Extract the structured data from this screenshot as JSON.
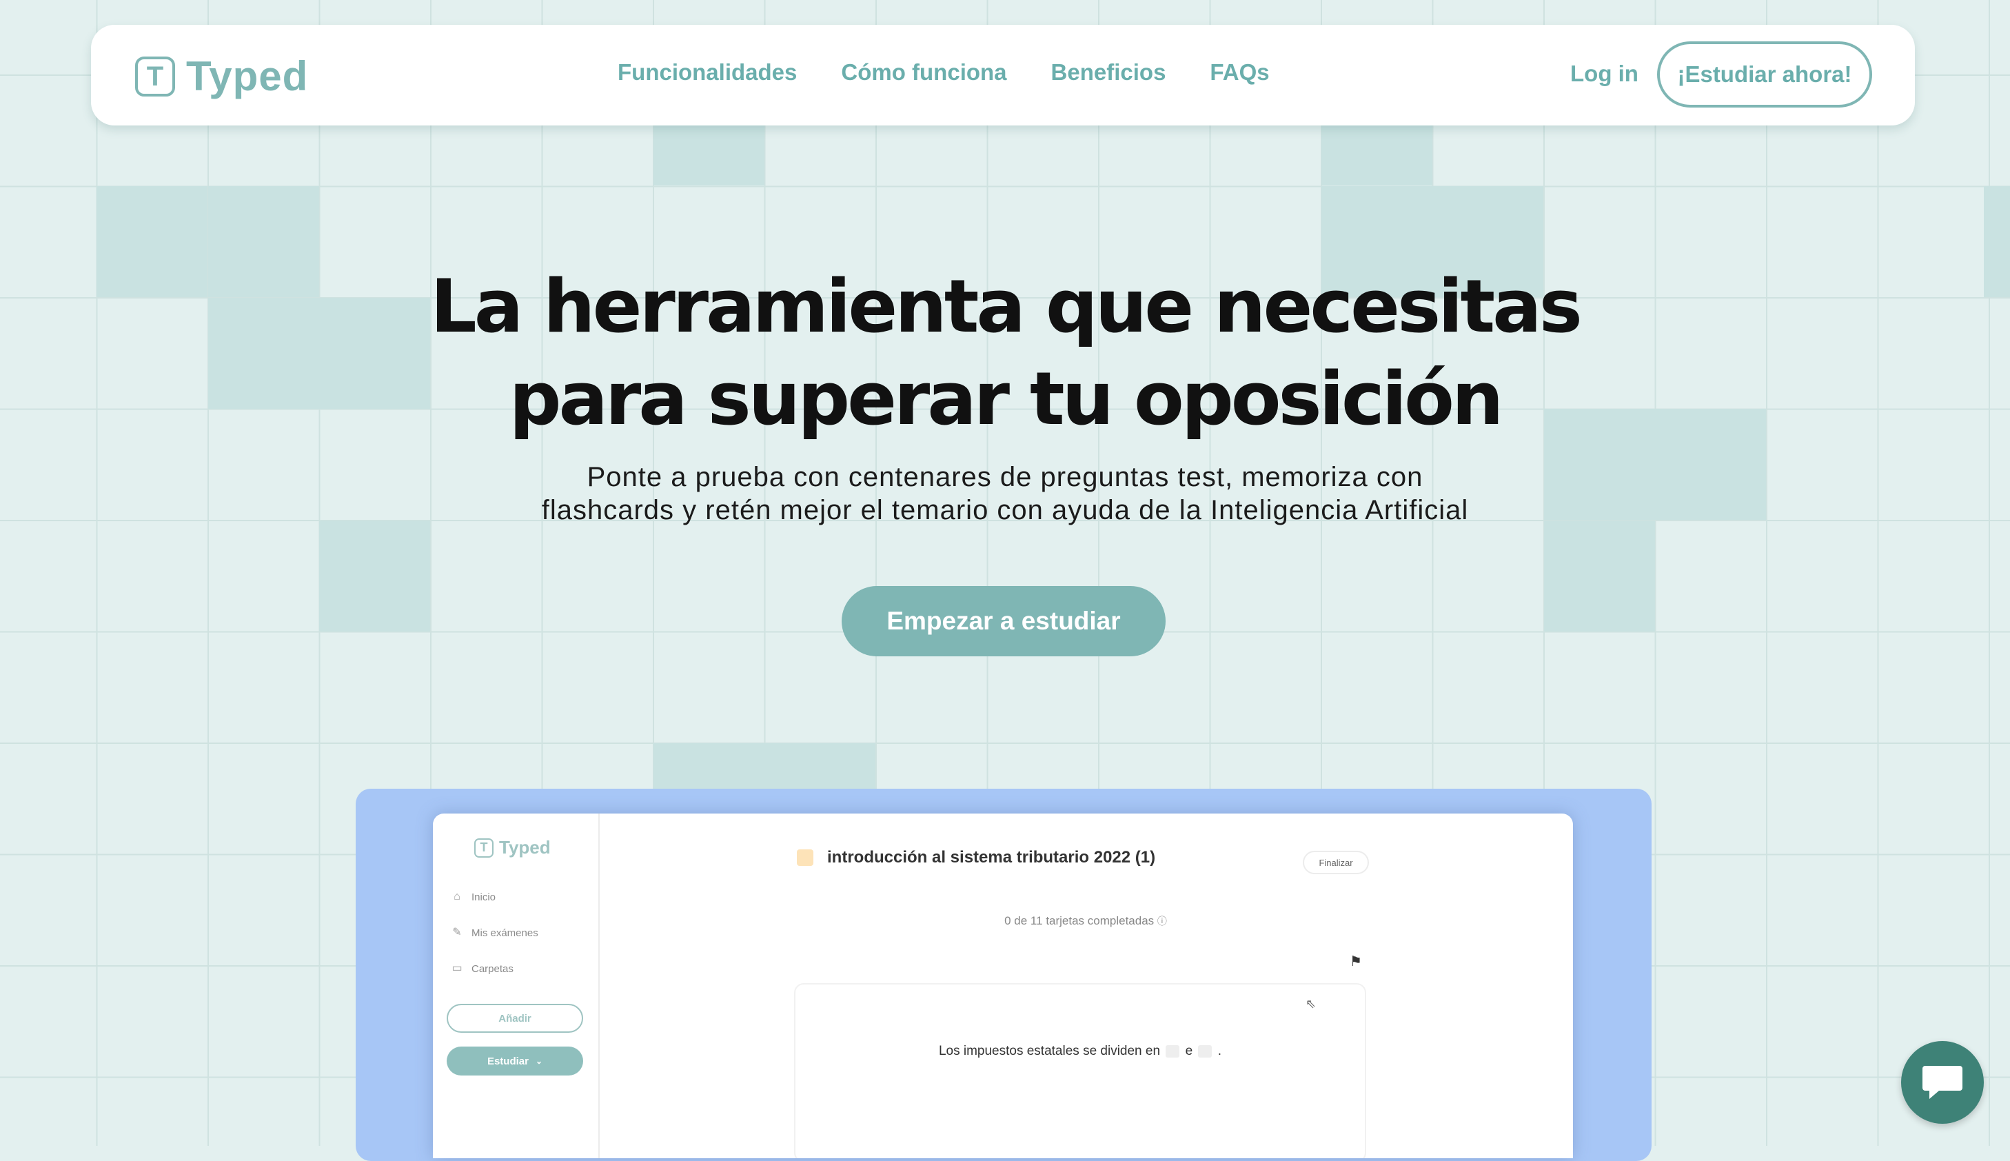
{
  "brand": {
    "logo_letter": "T",
    "name": "Typed",
    "color": "#7fb6b4"
  },
  "nav": {
    "links": [
      {
        "label": "Funcionalidades"
      },
      {
        "label": "Cómo funciona"
      },
      {
        "label": "Beneficios"
      },
      {
        "label": "FAQs"
      }
    ],
    "login_label": "Log in",
    "cta_label": "¡Estudiar ahora!"
  },
  "hero": {
    "title_line1": "La herramienta que necesitas",
    "title_line2": "para superar tu oposición",
    "subtitle_line1": "Ponte a prueba con centenares de preguntas test, memoriza con",
    "subtitle_line2": "flashcards y retén mejor el temario con ayuda de la Inteligencia Artificial",
    "cta_label": "Empezar a estudiar"
  },
  "preview": {
    "logo_letter": "T",
    "logo_name": "Typed",
    "sidebar": {
      "items": [
        {
          "label": "Inicio",
          "icon": "home-icon"
        },
        {
          "label": "Mis exámenes",
          "icon": "exam-icon"
        },
        {
          "label": "Carpetas",
          "icon": "folder-icon"
        }
      ],
      "add_label": "Añadir",
      "study_label": "Estudiar"
    },
    "deck_title": "introducción al sistema tributario 2022 (1)",
    "finish_label": "Finalizar",
    "progress": {
      "done": "0",
      "of": "de",
      "total": "11",
      "suffix": "tarjetas completadas"
    },
    "card": {
      "text_before": "Los impuestos estatales se dividen en",
      "conjunction": "e",
      "text_after": "."
    }
  },
  "chat": {
    "icon": "chat-icon"
  }
}
